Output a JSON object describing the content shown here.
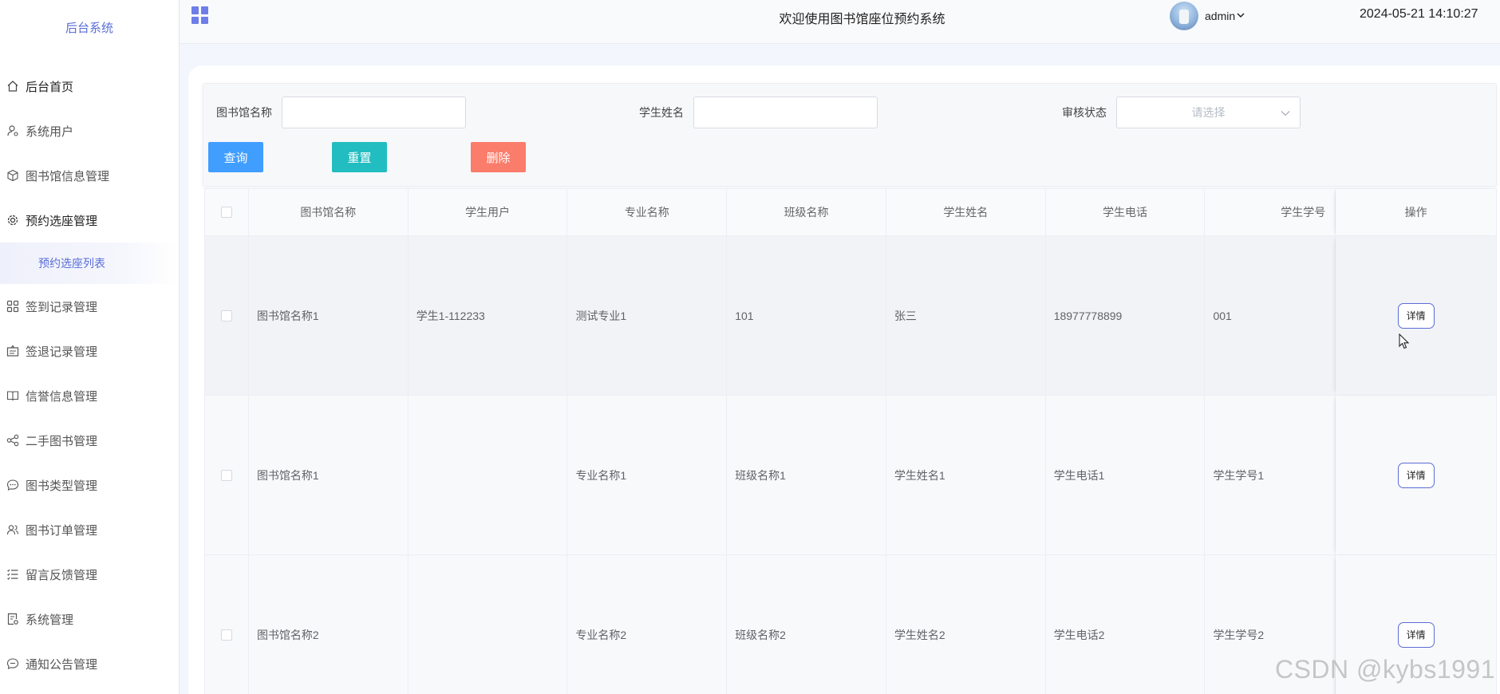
{
  "sidebar": {
    "brand": "后台系统",
    "items": [
      {
        "label": "后台首页",
        "icon": "home-icon"
      },
      {
        "label": "系统用户",
        "icon": "user-settings-icon"
      },
      {
        "label": "图书馆信息管理",
        "icon": "cube-icon"
      },
      {
        "label": "预约选座管理",
        "icon": "gear-icon"
      },
      {
        "label": "签到记录管理",
        "icon": "apps-icon"
      },
      {
        "label": "签退记录管理",
        "icon": "clipboard-icon"
      },
      {
        "label": "信誉信息管理",
        "icon": "book-icon"
      },
      {
        "label": "二手图书管理",
        "icon": "share-icon"
      },
      {
        "label": "图书类型管理",
        "icon": "chat-icon"
      },
      {
        "label": "图书订单管理",
        "icon": "users-icon"
      },
      {
        "label": "留言反馈管理",
        "icon": "list-check-icon"
      },
      {
        "label": "系统管理",
        "icon": "document-settings-icon"
      },
      {
        "label": "通知公告管理",
        "icon": "chat-dots-icon"
      }
    ],
    "submenu": {
      "label": "预约选座列表"
    }
  },
  "header": {
    "title": "欢迎使用图书馆座位预约系统",
    "user": "admin",
    "datetime": "2024-05-21 14:10:27"
  },
  "search": {
    "library_label": "图书馆名称",
    "library_value": "",
    "student_label": "学生姓名",
    "student_value": "",
    "status_label": "审核状态",
    "status_placeholder": "请选择",
    "query_label": "查询",
    "reset_label": "重置",
    "delete_label": "删除"
  },
  "table": {
    "columns": [
      "图书馆名称",
      "学生用户",
      "专业名称",
      "班级名称",
      "学生姓名",
      "学生电话",
      "学生学号",
      "操作"
    ],
    "rows": [
      {
        "library": "图书馆名称1",
        "user": "学生1-112233",
        "major": "测试专业1",
        "class": "101",
        "name": "张三",
        "phone": "18977778899",
        "no": "001",
        "action": "详情"
      },
      {
        "library": "图书馆名称1",
        "user": "",
        "major": "专业名称1",
        "class": "班级名称1",
        "name": "学生姓名1",
        "phone": "学生电话1",
        "no": "学生学号1",
        "action": "详情"
      },
      {
        "library": "图书馆名称2",
        "user": "",
        "major": "专业名称2",
        "class": "班级名称2",
        "name": "学生姓名2",
        "phone": "学生电话2",
        "no": "学生学号2",
        "action": "详情"
      }
    ]
  },
  "watermark": "CSDN @kybs1991",
  "colors": {
    "accent": "#5a6ed6",
    "query": "#409eff",
    "reset": "#22bdc0",
    "delete": "#fa7c6a"
  }
}
